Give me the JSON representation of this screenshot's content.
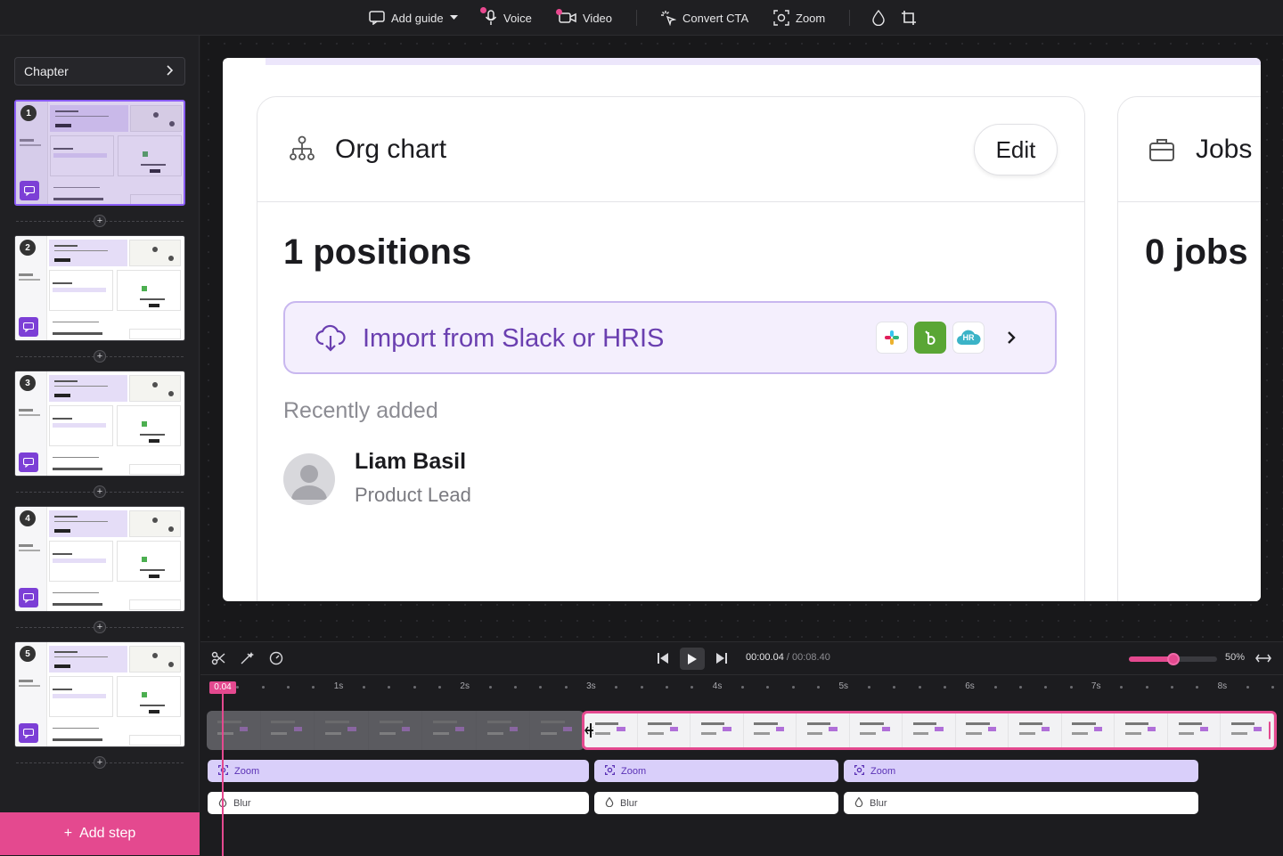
{
  "toolbar": {
    "add_guide": "Add guide",
    "voice": "Voice",
    "video": "Video",
    "convert_cta": "Convert CTA",
    "zoom": "Zoom"
  },
  "sidebar": {
    "chapter_label": "Chapter",
    "steps": [
      "1",
      "2",
      "3",
      "4",
      "5"
    ],
    "add_step": "Add step"
  },
  "canvas": {
    "org_card": {
      "title": "Org chart",
      "edit_label": "Edit",
      "count": "1 positions",
      "import_label": "Import from Slack or HRIS",
      "recent_label": "Recently added",
      "person_name": "Liam Basil",
      "person_role": "Product Lead",
      "integration_badge": "HR"
    },
    "jobs_card": {
      "title": "Jobs",
      "count": "0 jobs"
    }
  },
  "timeline": {
    "current_time": "00:00.04",
    "separator": " / ",
    "total_time": "00:08.40",
    "zoom_pct": "50%",
    "zoom_level": 0.5,
    "playhead_label": "0.04",
    "ruler_labels": [
      "1s",
      "2s",
      "3s",
      "4s",
      "5s",
      "6s",
      "7s",
      "8s"
    ],
    "zoom_lane_label": "Zoom",
    "blur_lane_label": "Blur"
  },
  "colors": {
    "accent": "#e4498f",
    "purple": "#7c3fd6",
    "zoom_lane": "#d9cffa"
  }
}
